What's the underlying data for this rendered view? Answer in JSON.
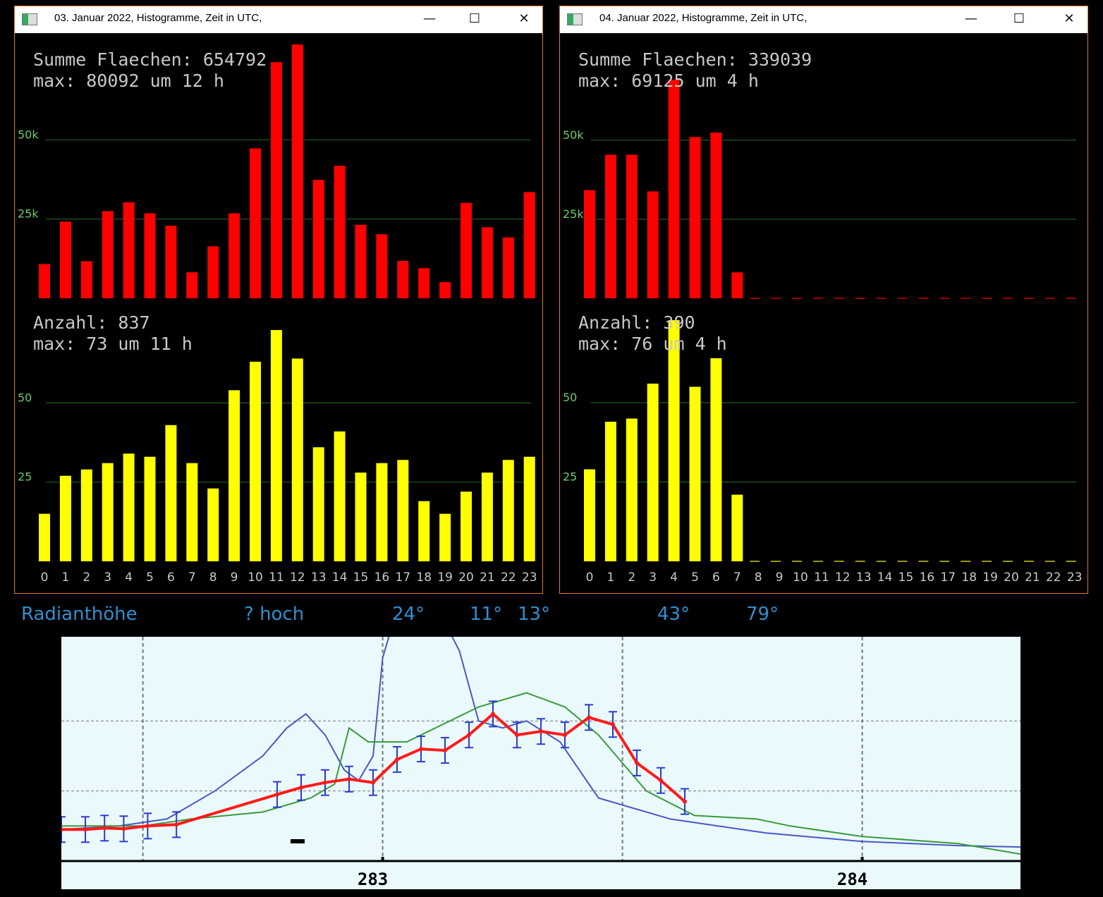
{
  "windows": [
    {
      "title": "03. Januar 2022, Histogramme, Zeit in UTC,",
      "controls": {
        "minimize": "—",
        "maximize": "☐",
        "close": "✕"
      },
      "red_panel": {
        "summary_line1": "Summe Flaechen: 654792",
        "summary_line2": "max: 80092 um 12 h"
      },
      "yellow_panel": {
        "summary_line1": "Anzahl: 837",
        "summary_line2": "max: 73 um 11 h"
      }
    },
    {
      "title": "04. Januar 2022, Histogramme, Zeit in UTC,",
      "controls": {
        "minimize": "—",
        "maximize": "☐",
        "close": "✕"
      },
      "red_panel": {
        "summary_line1": "Summe Flaechen: 339039",
        "summary_line2": "max: 69125 um 4 h"
      },
      "yellow_panel": {
        "summary_line1": "Anzahl: 390",
        "summary_line2": "max: 76 um 4 h"
      }
    }
  ],
  "radiant_labels": [
    "Radianthöhe",
    "? hoch",
    "24°",
    "11°",
    "13°",
    "43°",
    "79°"
  ],
  "chart_data": [
    {
      "type": "bar",
      "title": "Summe Flaechen: 654792",
      "categories": [
        "0",
        "1",
        "2",
        "3",
        "4",
        "5",
        "6",
        "7",
        "8",
        "9",
        "10",
        "11",
        "12",
        "13",
        "14",
        "15",
        "16",
        "17",
        "18",
        "19",
        "20",
        "21",
        "22",
        "23"
      ],
      "values": [
        10800,
        24200,
        11700,
        27500,
        30300,
        26800,
        22900,
        8200,
        16400,
        26800,
        47300,
        74500,
        80092,
        37400,
        41800,
        23200,
        20200,
        11800,
        9500,
        5100,
        30100,
        22400,
        19200,
        33500
      ],
      "ytick_labels": [
        "50k",
        "25k"
      ],
      "ytick_values": [
        50000,
        25000
      ],
      "ylim": [
        0,
        80092
      ],
      "color": "#ff0000",
      "grid_color": "#1e5a1e"
    },
    {
      "type": "bar",
      "title": "Anzahl: 837",
      "categories": [
        "0",
        "1",
        "2",
        "3",
        "4",
        "5",
        "6",
        "7",
        "8",
        "9",
        "10",
        "11",
        "12",
        "13",
        "14",
        "15",
        "16",
        "17",
        "18",
        "19",
        "20",
        "21",
        "22",
        "23"
      ],
      "values": [
        15,
        27,
        29,
        31,
        34,
        33,
        43,
        31,
        23,
        54,
        63,
        73,
        64,
        36,
        41,
        28,
        31,
        32,
        19,
        15,
        22,
        28,
        32,
        33
      ],
      "ytick_labels": [
        "50",
        "25"
      ],
      "ytick_values": [
        50,
        25
      ],
      "ylim": [
        0,
        73
      ],
      "color": "#ffff00",
      "grid_color": "#1e5a1e"
    },
    {
      "type": "bar",
      "title": "Summe Flaechen: 339039",
      "categories": [
        "0",
        "1",
        "2",
        "3",
        "4",
        "5",
        "6",
        "7",
        "8",
        "9",
        "10",
        "11",
        "12",
        "13",
        "14",
        "15",
        "16",
        "17",
        "18",
        "19",
        "20",
        "21",
        "22",
        "23"
      ],
      "values": [
        34200,
        45400,
        45400,
        33800,
        69125,
        51000,
        52400,
        8200,
        null,
        null,
        null,
        null,
        null,
        null,
        null,
        null,
        null,
        null,
        null,
        null,
        null,
        null,
        null,
        null
      ],
      "ytick_labels": [
        "50k",
        "25k"
      ],
      "ytick_values": [
        50000,
        25000
      ],
      "ylim": [
        0,
        69125
      ],
      "color": "#ff0000",
      "grid_color": "#1e5a1e"
    },
    {
      "type": "bar",
      "title": "Anzahl: 390",
      "categories": [
        "0",
        "1",
        "2",
        "3",
        "4",
        "5",
        "6",
        "7",
        "8",
        "9",
        "10",
        "11",
        "12",
        "13",
        "14",
        "15",
        "16",
        "17",
        "18",
        "19",
        "20",
        "21",
        "22",
        "23"
      ],
      "values": [
        29,
        44,
        45,
        56,
        76,
        55,
        64,
        21,
        null,
        null,
        null,
        null,
        null,
        null,
        null,
        null,
        null,
        null,
        null,
        null,
        null,
        null,
        null,
        null
      ],
      "ytick_labels": [
        "50",
        "25"
      ],
      "ytick_values": [
        50,
        25
      ],
      "ylim": [
        0,
        76
      ],
      "color": "#ffff00",
      "grid_color": "#1e5a1e"
    },
    {
      "type": "line",
      "xtick_labels": [
        "283",
        "284"
      ],
      "xtick_values": [
        283,
        284
      ],
      "xlim": [
        282.33,
        284.33
      ],
      "ylim": [
        0,
        3
      ],
      "series": [
        {
          "color": "#4a57c8",
          "values": [
            [
              282.33,
              0.45
            ],
            [
              282.45,
              0.5
            ],
            [
              282.55,
              0.6
            ],
            [
              282.65,
              1.0
            ],
            [
              282.75,
              1.5
            ],
            [
              282.8,
              1.9
            ],
            [
              282.84,
              2.1
            ],
            [
              282.88,
              1.8
            ],
            [
              282.92,
              1.3
            ],
            [
              282.95,
              1.15
            ],
            [
              282.98,
              1.5
            ],
            [
              283.0,
              2.9
            ],
            [
              283.03,
              3.6
            ],
            [
              283.1,
              3.8
            ],
            [
              283.16,
              3.0
            ],
            [
              283.2,
              2.0
            ],
            [
              283.25,
              1.9
            ],
            [
              283.3,
              2.0
            ],
            [
              283.37,
              1.7
            ],
            [
              283.45,
              0.9
            ],
            [
              283.6,
              0.6
            ],
            [
              283.8,
              0.4
            ],
            [
              284.0,
              0.28
            ],
            [
              284.2,
              0.22
            ],
            [
              284.33,
              0.2
            ]
          ]
        },
        {
          "color": "#3a9a3a",
          "values": [
            [
              282.33,
              0.5
            ],
            [
              282.5,
              0.5
            ],
            [
              282.6,
              0.6
            ],
            [
              282.75,
              0.7
            ],
            [
              282.85,
              0.9
            ],
            [
              282.9,
              1.1
            ],
            [
              282.93,
              1.9
            ],
            [
              282.97,
              1.7
            ],
            [
              283.05,
              1.7
            ],
            [
              283.2,
              2.2
            ],
            [
              283.3,
              2.4
            ],
            [
              283.38,
              2.2
            ],
            [
              283.45,
              1.8
            ],
            [
              283.55,
              1.0
            ],
            [
              283.65,
              0.65
            ],
            [
              283.78,
              0.6
            ],
            [
              283.85,
              0.5
            ],
            [
              284.0,
              0.35
            ],
            [
              284.2,
              0.25
            ],
            [
              284.33,
              0.1
            ]
          ]
        },
        {
          "color": "#ff1a1a",
          "values": [
            [
              282.33,
              0.45
            ],
            [
              282.38,
              0.45
            ],
            [
              282.42,
              0.47
            ],
            [
              282.46,
              0.46
            ],
            [
              282.51,
              0.5
            ],
            [
              282.57,
              0.52
            ],
            [
              282.78,
              0.95
            ],
            [
              282.83,
              1.05
            ],
            [
              282.88,
              1.12
            ],
            [
              282.93,
              1.17
            ],
            [
              282.98,
              1.12
            ],
            [
              283.03,
              1.45
            ],
            [
              283.08,
              1.6
            ],
            [
              283.13,
              1.58
            ],
            [
              283.18,
              1.8
            ],
            [
              283.23,
              2.1
            ],
            [
              283.28,
              1.8
            ],
            [
              283.33,
              1.85
            ],
            [
              283.38,
              1.8
            ],
            [
              283.43,
              2.05
            ],
            [
              283.48,
              1.95
            ],
            [
              283.53,
              1.4
            ],
            [
              283.58,
              1.15
            ],
            [
              283.63,
              0.85
            ]
          ]
        }
      ]
    }
  ]
}
